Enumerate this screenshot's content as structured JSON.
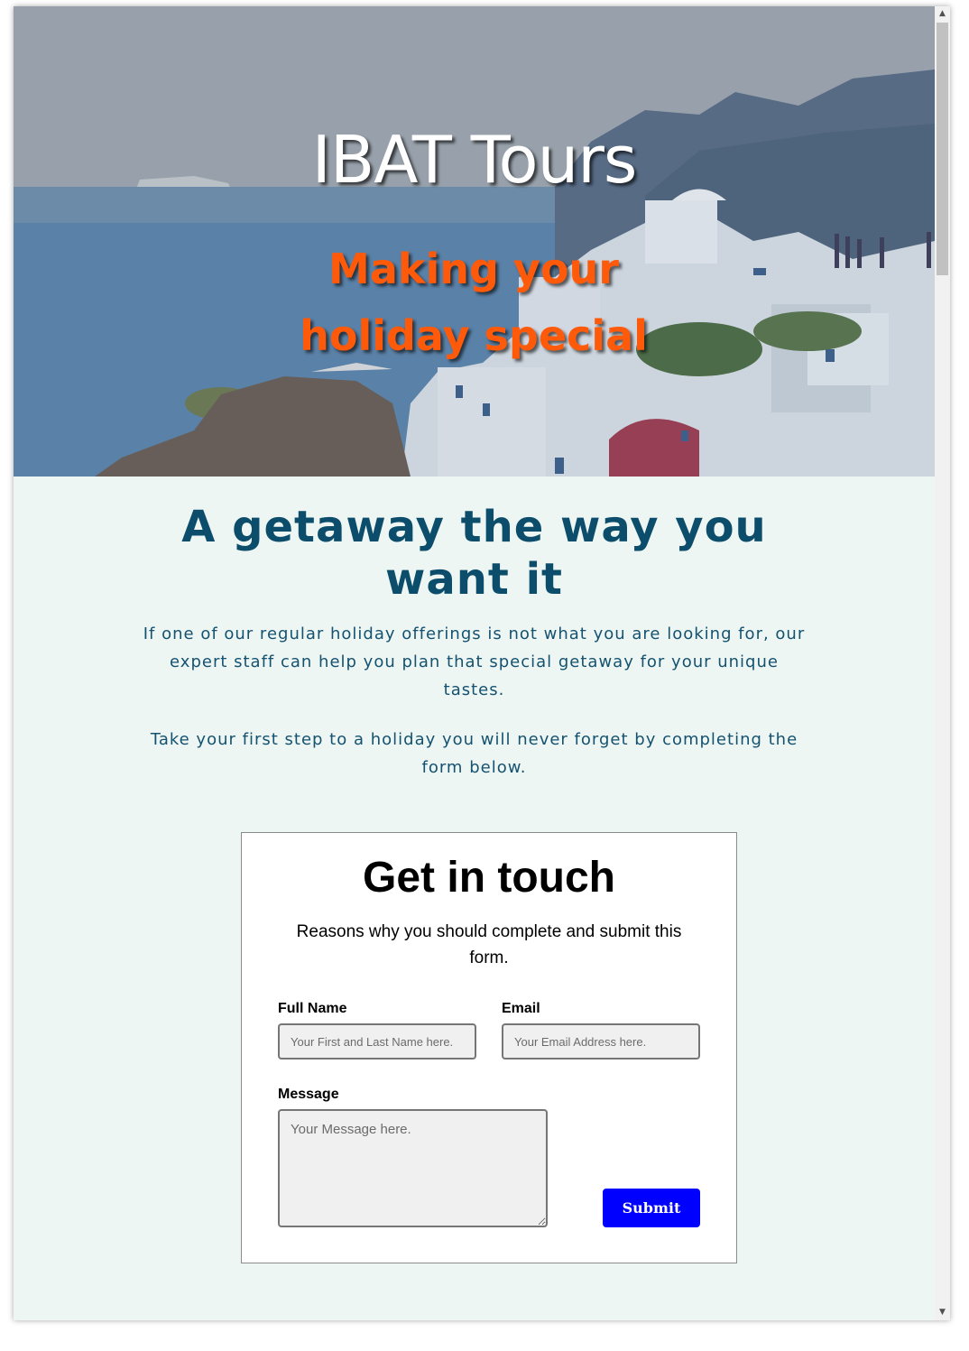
{
  "hero": {
    "title": "IBAT Tours",
    "subtitle": "Making your holiday special"
  },
  "intro": {
    "heading": "A getaway the way you want it",
    "paragraph1": "If one of our regular holiday offerings is not what you are looking for, our expert staff can help you plan that special getaway for your unique tastes.",
    "paragraph2": "Take your first step to a holiday you will never forget by completing the form below."
  },
  "form": {
    "title": "Get in touch",
    "description": "Reasons why you should complete and submit this form.",
    "full_name": {
      "label": "Full Name",
      "placeholder": "Your First and Last Name here.",
      "value": ""
    },
    "email": {
      "label": "Email",
      "placeholder": "Your Email Address here.",
      "value": ""
    },
    "message": {
      "label": "Message",
      "placeholder": "Your Message here.",
      "value": ""
    },
    "submit_label": "Submit"
  },
  "scrollbar": {
    "up_icon": "scroll-up-arrow-icon",
    "down_icon": "scroll-down-arrow-icon"
  },
  "colors": {
    "page_background": "#eef6f3",
    "heading_blue": "#0c4d6b",
    "subtitle_orange": "#ff5a0a",
    "submit_blue": "#0000ff"
  }
}
